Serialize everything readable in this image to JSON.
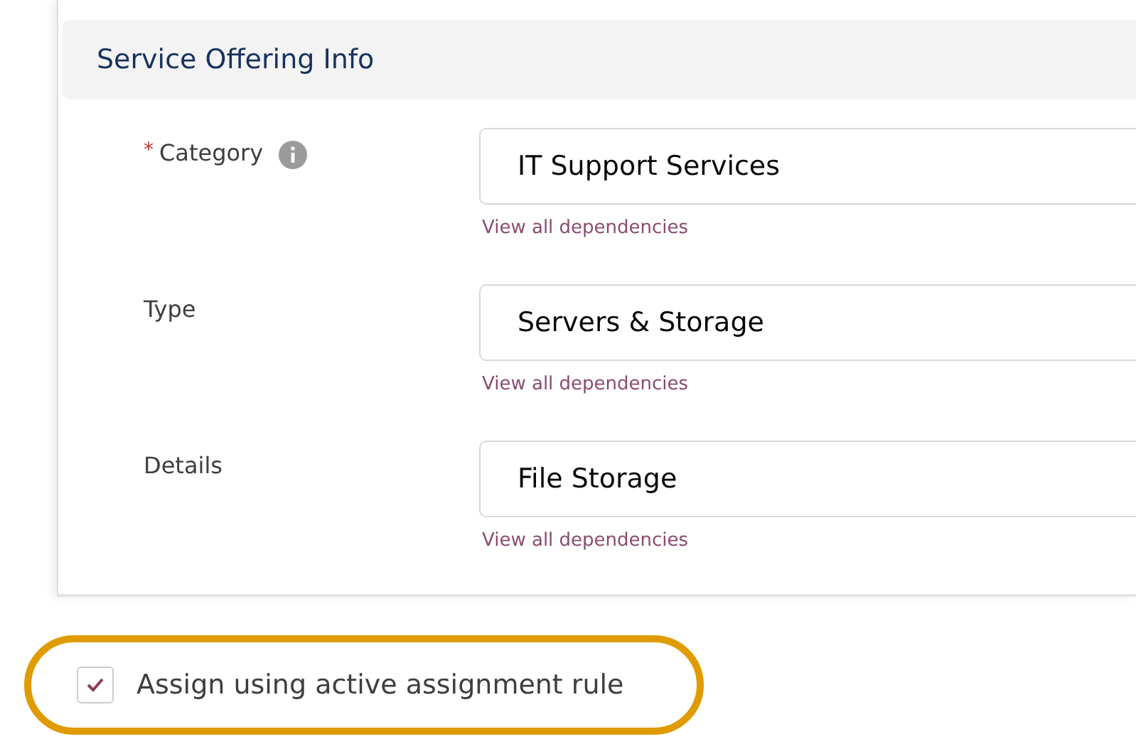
{
  "section": {
    "title": "Service Offering Info"
  },
  "fields": [
    {
      "label": "Category",
      "required": true,
      "info": true,
      "value": "IT Support Services",
      "link": "View all dependencies"
    },
    {
      "label": "Type",
      "required": false,
      "info": false,
      "value": "Servers & Storage",
      "link": "View all dependencies"
    },
    {
      "label": "Details",
      "required": false,
      "info": false,
      "value": "File Storage",
      "link": "View all dependencies"
    }
  ],
  "required_mark": "*",
  "assign_checkbox": {
    "label": "Assign using active assignment rule",
    "checked": true,
    "highlighted": true
  }
}
